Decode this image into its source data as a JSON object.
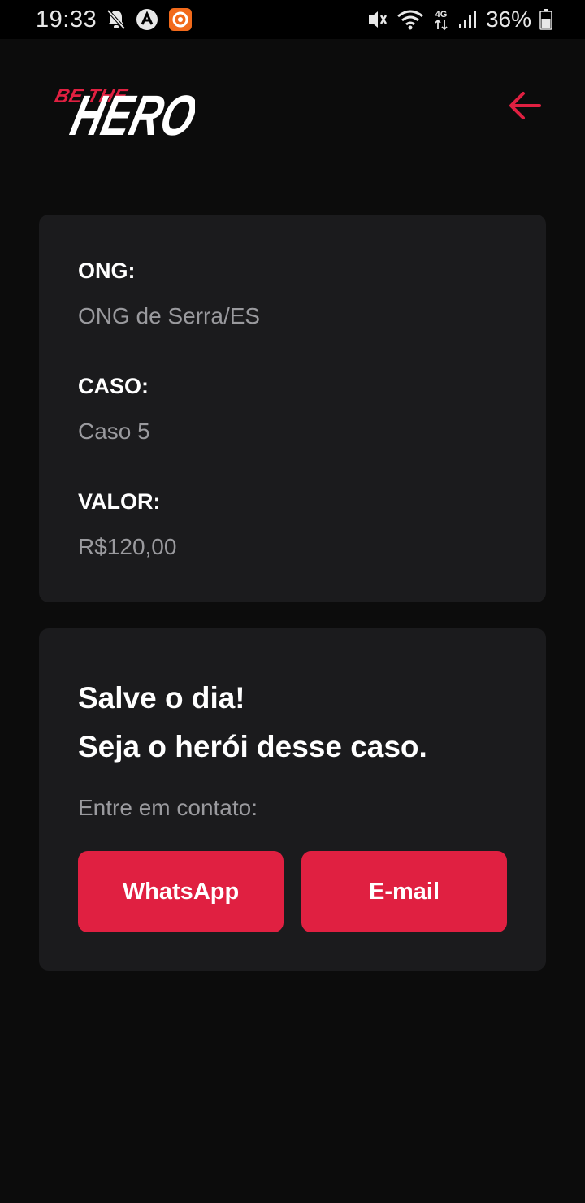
{
  "status_bar": {
    "time": "19:33",
    "battery": "36%",
    "network": "4G",
    "icons": [
      "mute-notifications-icon",
      "assistant-icon",
      "app-notification-icon",
      "vibrate-icon",
      "wifi-icon",
      "mobile-data-icon",
      "signal-icon",
      "battery-icon"
    ]
  },
  "header": {
    "logo_text_small": "BE THE",
    "logo_text_large": "HERO",
    "back_icon": "arrow-left-icon"
  },
  "incident": {
    "ong_label": "ONG:",
    "ong_value": "ONG de Serra/ES",
    "case_label": "CASO:",
    "case_value": "Caso 5",
    "value_label": "VALOR:",
    "value_value": "R$120,00"
  },
  "contact": {
    "title_line1": "Salve o dia!",
    "title_line2": "Seja o herói desse caso.",
    "description": "Entre em contato:",
    "whatsapp_label": "WhatsApp",
    "email_label": "E-mail"
  },
  "colors": {
    "background": "#0c0c0c",
    "card": "#1b1b1d",
    "accent": "#e02041",
    "muted_text": "#9a9a9e"
  }
}
